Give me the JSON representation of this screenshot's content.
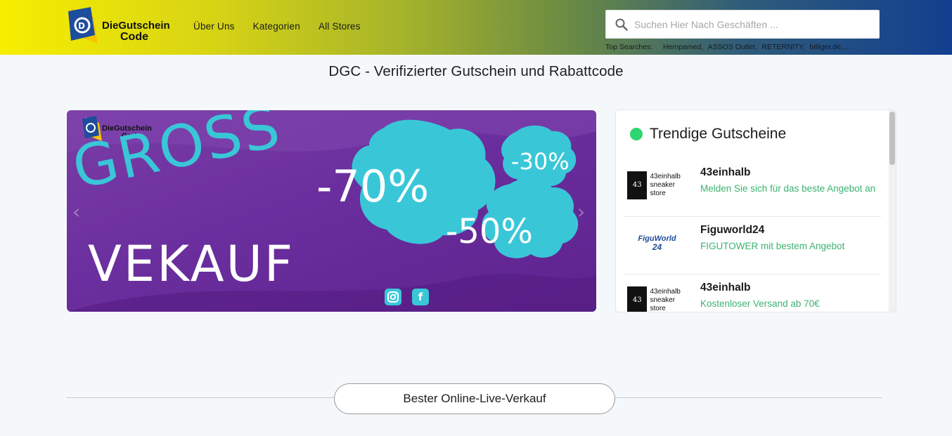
{
  "header": {
    "logo_line1": "DieGutschein",
    "logo_line2": "Code",
    "nav": [
      "Über Uns",
      "Kategorien",
      "All Stores"
    ],
    "search_placeholder": "Suchen Hier Nach Geschäften ...",
    "top_searches_label": "Top Searches:",
    "top_searches": [
      "Hempamed,",
      "ASSOS Outlet,",
      "RETERNITY,",
      "billiger.de,..."
    ]
  },
  "page_title": "DGC - Verifizierter Gutschein und Rabattcode",
  "banner": {
    "brand_line1": "DieGutschein",
    "brand_line2": "Code",
    "headline1": "GROSS",
    "headline2": "VEKAUF",
    "discount1": "-70%",
    "discount2": "-50%",
    "discount3": "-30%",
    "instagram": "instagram-icon",
    "facebook": "facebook-icon",
    "accent": "#39c7d8",
    "bg": "#6b2e9e"
  },
  "trending": {
    "title": "Trendige Gutscheine",
    "items": [
      {
        "logo_text1": "43einhalb",
        "logo_text2": "sneaker store",
        "name": "43einhalb",
        "desc": "Melden Sie sich für das beste Angebot an"
      },
      {
        "logo_text1": "FiguWorld",
        "logo_text2": "24",
        "name": "Figuworld24",
        "desc": "FIGUTOWER mit bestem Angebot"
      },
      {
        "logo_text1": "43einhalb",
        "logo_text2": "sneaker store",
        "name": "43einhalb",
        "desc": "Kostenloser Versand ab 70€"
      }
    ]
  },
  "section": {
    "label": "Bester Online-Live-Verkauf"
  }
}
